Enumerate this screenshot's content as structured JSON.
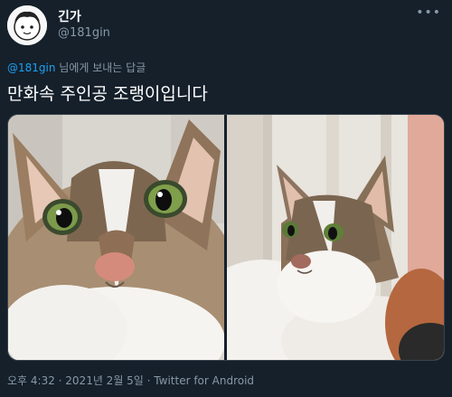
{
  "tweet": {
    "display_name": "긴가",
    "handle": "@181gin",
    "more_icon": "ellipsis-icon",
    "reply_mention": "@181gin",
    "reply_suffix": " 님에게 보내는 답글",
    "text": "만화속 주인공 조랭이입니다",
    "time_date": "오후 4:32 · 2021년 2월 5일 · ",
    "client": "Twitter for Android"
  },
  "colors": {
    "background": "#15202b",
    "secondary_text": "#8899a6",
    "link": "#1da1f2"
  }
}
